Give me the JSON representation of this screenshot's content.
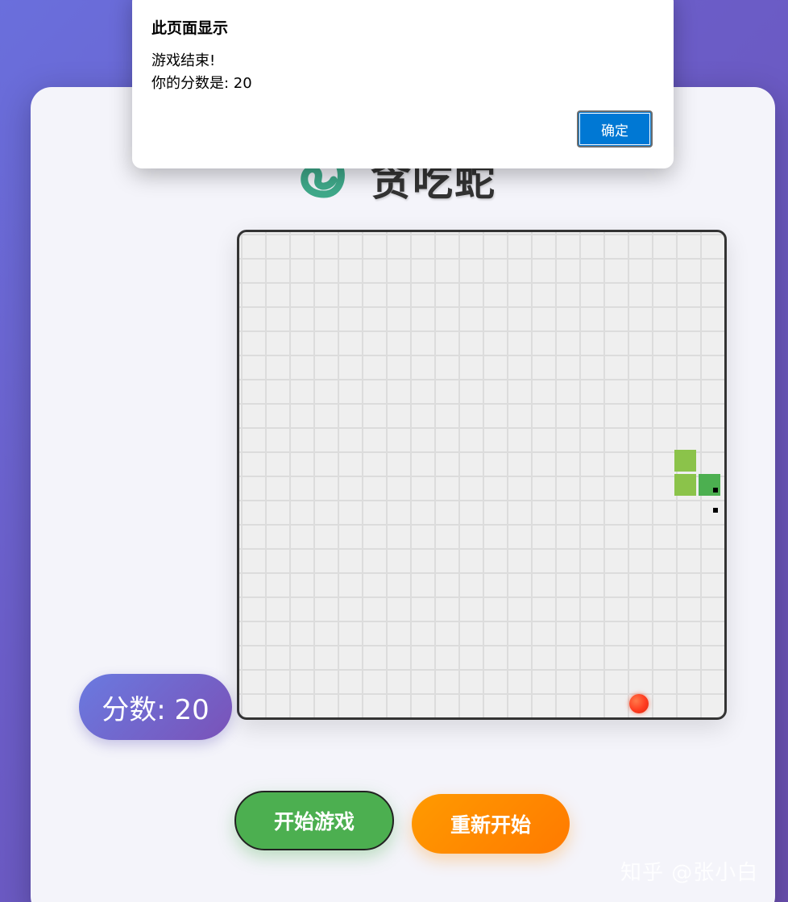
{
  "app": {
    "title": "贪吃蛇",
    "logo_icon": "snake-icon"
  },
  "score": {
    "label": "分数: 20",
    "value": 20
  },
  "board": {
    "columns": 20,
    "rows": 20,
    "snake_color": "#8bc34a",
    "snake_head_color": "#4caf50",
    "food_color": "#ff4422"
  },
  "buttons": {
    "start_label": "开始游戏",
    "restart_label": "重新开始"
  },
  "dialog": {
    "title": "此页面显示",
    "message_line1": "游戏结束!",
    "message_line2": "你的分数是: 20",
    "ok_label": "确定"
  },
  "watermark": "知乎 @张小白"
}
